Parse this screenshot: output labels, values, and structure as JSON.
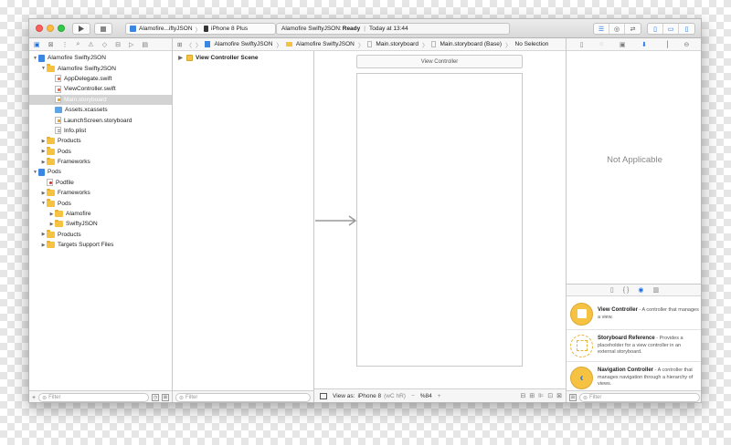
{
  "toolbar": {
    "scheme": {
      "target": "Alamofire...iftyJSON",
      "device": "iPhone 8 Plus"
    },
    "status": {
      "prefix": "Alamofire SwiftyJSON:",
      "state": "Ready",
      "time": "Today at 13:44"
    }
  },
  "jumpbar": {
    "items": [
      "Alamofire SwiftyJSON",
      "Alamofire SwiftyJSON",
      "Main.storyboard",
      "Main.storyboard (Base)",
      "No Selection"
    ]
  },
  "navigator": {
    "tree": [
      {
        "label": "Alamofire SwiftyJSON",
        "icon": "project-icon",
        "depth": 0,
        "disclosure": "down"
      },
      {
        "label": "Alamofire SwiftyJSON",
        "icon": "folder-icon",
        "depth": 1,
        "disclosure": "down"
      },
      {
        "label": "AppDelegate.swift",
        "icon": "swift-file-icon",
        "depth": 2
      },
      {
        "label": "ViewController.swift",
        "icon": "swift-file-icon",
        "depth": 2
      },
      {
        "label": "Main.storyboard",
        "icon": "storyboard-file-icon",
        "depth": 2,
        "selected": true
      },
      {
        "label": "Assets.xcassets",
        "icon": "asset-catalog-icon",
        "depth": 2
      },
      {
        "label": "LaunchScreen.storyboard",
        "icon": "storyboard-file-icon",
        "depth": 2
      },
      {
        "label": "Info.plist",
        "icon": "plist-file-icon",
        "depth": 2
      },
      {
        "label": "Products",
        "icon": "folder-icon",
        "depth": 1,
        "disclosure": "right"
      },
      {
        "label": "Pods",
        "icon": "folder-icon",
        "depth": 1,
        "disclosure": "right"
      },
      {
        "label": "Frameworks",
        "icon": "folder-icon",
        "depth": 1,
        "disclosure": "right"
      },
      {
        "label": "Pods",
        "icon": "project-icon",
        "depth": 0,
        "disclosure": "down"
      },
      {
        "label": "Podfile",
        "icon": "podfile-icon",
        "depth": 1
      },
      {
        "label": "Frameworks",
        "icon": "folder-icon",
        "depth": 1,
        "disclosure": "right"
      },
      {
        "label": "Pods",
        "icon": "folder-icon",
        "depth": 1,
        "disclosure": "down"
      },
      {
        "label": "Alamofire",
        "icon": "folder-icon",
        "depth": 2,
        "disclosure": "right"
      },
      {
        "label": "SwiftyJSON",
        "icon": "folder-icon",
        "depth": 2,
        "disclosure": "right"
      },
      {
        "label": "Products",
        "icon": "folder-icon",
        "depth": 1,
        "disclosure": "right"
      },
      {
        "label": "Targets Support Files",
        "icon": "folder-icon",
        "depth": 1,
        "disclosure": "right"
      }
    ],
    "filter_placeholder": "Filter"
  },
  "outline": {
    "scene": "View Controller Scene",
    "filter_placeholder": "Filter"
  },
  "canvas": {
    "scene_title": "View Controller",
    "view_as_label": "View as:",
    "view_as_device": "iPhone 8",
    "size_class": "(wC hR)",
    "zoom_minus": "−",
    "zoom": "%84",
    "zoom_plus": "+"
  },
  "inspector": {
    "not_applicable": "Not Applicable",
    "library": [
      {
        "title": "View Controller",
        "desc": " - A controller that manages a view.",
        "icon": "view-controller-icon"
      },
      {
        "title": "Storyboard Reference",
        "desc": " - Provides a placeholder for a view controller in an external storyboard.",
        "icon": "storyboard-reference-icon"
      },
      {
        "title": "Navigation Controller",
        "desc": " - A controller that manages navigation through a hierarchy of views.",
        "icon": "navigation-controller-icon"
      }
    ],
    "filter_placeholder": "Filter"
  },
  "colors": {
    "accent": "#1a6fe3",
    "folder": "#f5c242",
    "selection": "#d3d3d3"
  }
}
